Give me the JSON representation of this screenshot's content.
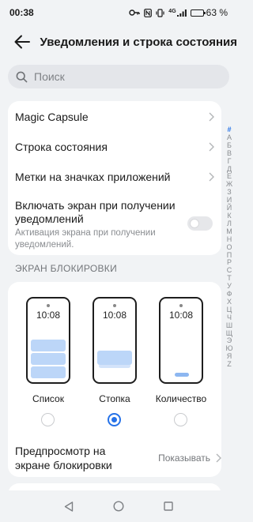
{
  "status_bar": {
    "time": "00:38",
    "signal_text": "4G",
    "battery": "63 %",
    "battery_level": 0.63
  },
  "header": {
    "title": "Уведомления и строка состояния"
  },
  "search": {
    "placeholder": "Поиск"
  },
  "settings_group": {
    "items": [
      {
        "label": "Magic Capsule"
      },
      {
        "label": "Строка состояния"
      },
      {
        "label": "Метки на значках приложений"
      }
    ],
    "wake_screen": {
      "label": "Включать экран при получении уведомлений",
      "sublabel": "Активация экрана при получении уведомлений.",
      "enabled": false
    }
  },
  "lock_screen": {
    "section_title": "ЭКРАН БЛОКИРОВКИ",
    "styles": [
      {
        "label": "Список",
        "clock": "10:08",
        "selected": false
      },
      {
        "label": "Стопка",
        "clock": "10:08",
        "selected": true
      },
      {
        "label": "Количество",
        "clock": "10:08",
        "selected": false
      }
    ],
    "preview": {
      "label": "Предпросмотр на экране блокировки",
      "value": "Показывать"
    }
  },
  "next_toggle": {
    "enabled": true
  },
  "alpha_index": [
    "#",
    "A",
    "Б",
    "В",
    "Г",
    "Д",
    "Е",
    "Ж",
    "З",
    "И",
    "Й",
    "К",
    "Л",
    "М",
    "Н",
    "О",
    "П",
    "Р",
    "С",
    "Т",
    "У",
    "Ф",
    "Х",
    "Ц",
    "Ч",
    "Ш",
    "Щ",
    "Э",
    "Ю",
    "Я",
    "Z"
  ],
  "colors": {
    "accent": "#2672e8",
    "background": "#f1f3f5",
    "card": "#ffffff"
  }
}
